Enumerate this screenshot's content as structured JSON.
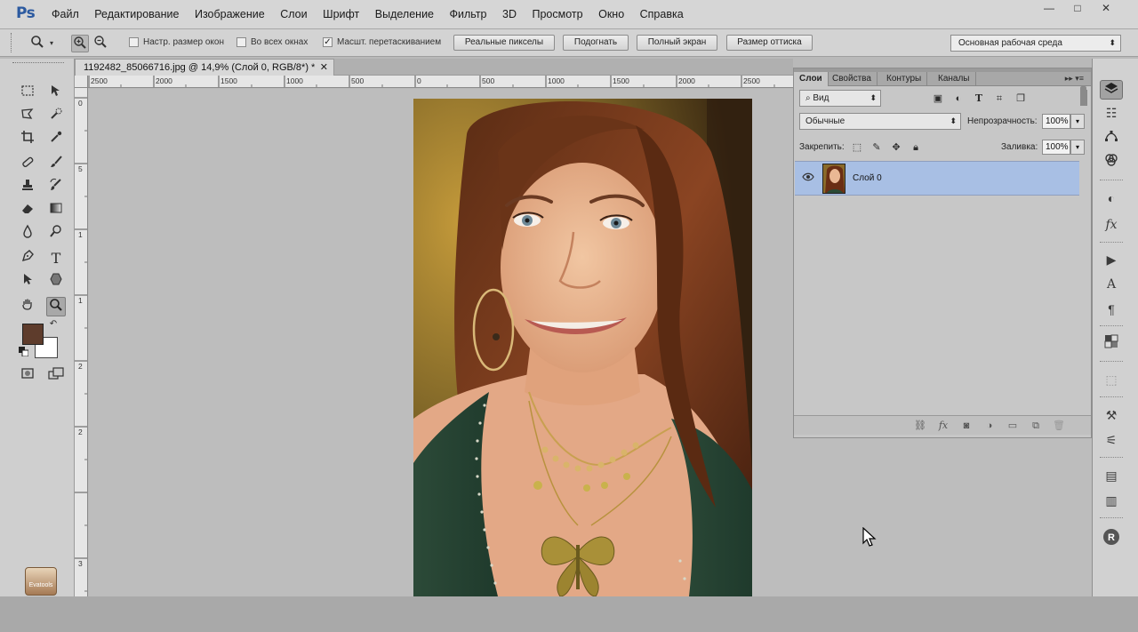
{
  "app": {
    "logo": "Ps"
  },
  "menu": [
    "Файл",
    "Редактирование",
    "Изображение",
    "Слои",
    "Шрифт",
    "Выделение",
    "Фильтр",
    "3D",
    "Просмотр",
    "Окно",
    "Справка"
  ],
  "window_controls": {
    "minimize": "—",
    "maximize": "□",
    "close": "✕"
  },
  "options": {
    "checkbox_resize_windows": "Настр. размер окон",
    "checkbox_all_windows": "Во всех окнах",
    "checkbox_scrubby_zoom": "Масшт. перетаскиванием",
    "scrubby_checked": "✓",
    "btn_actual_pixels": "Реальные пикселы",
    "btn_fit": "Подогнать",
    "btn_fill_screen": "Полный экран",
    "btn_print_size": "Размер оттиска",
    "workspace": "Основная рабочая среда"
  },
  "document": {
    "tab_title": "1192482_85066716.jpg @ 14,9% (Слой 0, RGB/8*) *",
    "close": "✕"
  },
  "ruler": {
    "h_labels": [
      "2500",
      "2000",
      "1500",
      "1000",
      "500",
      "0",
      "500",
      "1000",
      "1500",
      "2000",
      "2500"
    ],
    "v_labels": [
      "0",
      "5",
      "1",
      "1",
      "2",
      "2",
      "3"
    ]
  },
  "layers_panel": {
    "tabs": [
      "Слои",
      "Свойства",
      "Контуры",
      "Каналы"
    ],
    "menu_glyph": "▸▸ ▾≡",
    "filter_kind": "Вид",
    "blend_mode": "Обычные",
    "opacity_label": "Непрозрачность:",
    "opacity_value": "100%",
    "lock_label": "Закрепить:",
    "fill_label": "Заливка:",
    "fill_value": "100%",
    "layers": [
      {
        "name": "Слой 0",
        "visible": true,
        "selected": true
      }
    ]
  },
  "toolbar": {
    "mascot_text": "Evatools"
  },
  "colors": {
    "foreground": "#5e3c2c",
    "background": "#ffffff",
    "layer_selected": "#a8bfe4",
    "canvas_bg": "#bdbdbd"
  }
}
